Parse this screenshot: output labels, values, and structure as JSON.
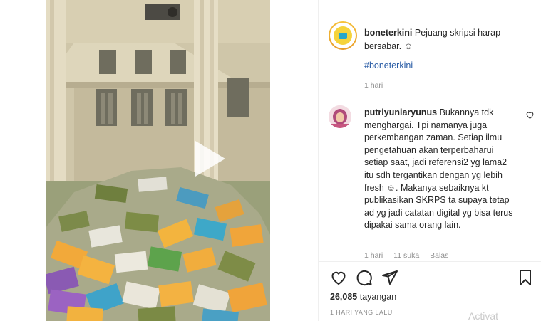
{
  "post": {
    "username": "boneterkini",
    "caption": "Pejuang skripsi harap bersabar. ☺",
    "hashtag": "#boneterkini",
    "time": "1 hari"
  },
  "comment": {
    "username": "putriyuniaryunus",
    "text": "Bukannya tdk menghargai. Tpi namanya juga perkembangan zaman. Setiap ilmu pengetahuan akan terperbaharui setiap saat, jadi referensi2 yg lama2 itu sdh tergantikan dengan yg lebih fresh ☺. Makanya sebaiknya kt publikasikan SKRPS ta supaya tetap ad yg jadi catatan digital yg bisa terus dipakai sama orang lain.",
    "time": "1 hari",
    "likes": "11 suka",
    "reply": "Balas"
  },
  "footer": {
    "views_count": "26,085",
    "views_label": "tayangan",
    "date": "1 HARI YANG LALU",
    "watermark": "Activat"
  },
  "icons": {
    "like": "heart-icon",
    "comment": "comment-icon",
    "share": "share-icon",
    "save": "bookmark-icon",
    "play": "play-icon"
  },
  "colors": {
    "link": "#2b5da6",
    "muted": "#8e8e8e",
    "avatar_ring": "#f6c33b"
  }
}
